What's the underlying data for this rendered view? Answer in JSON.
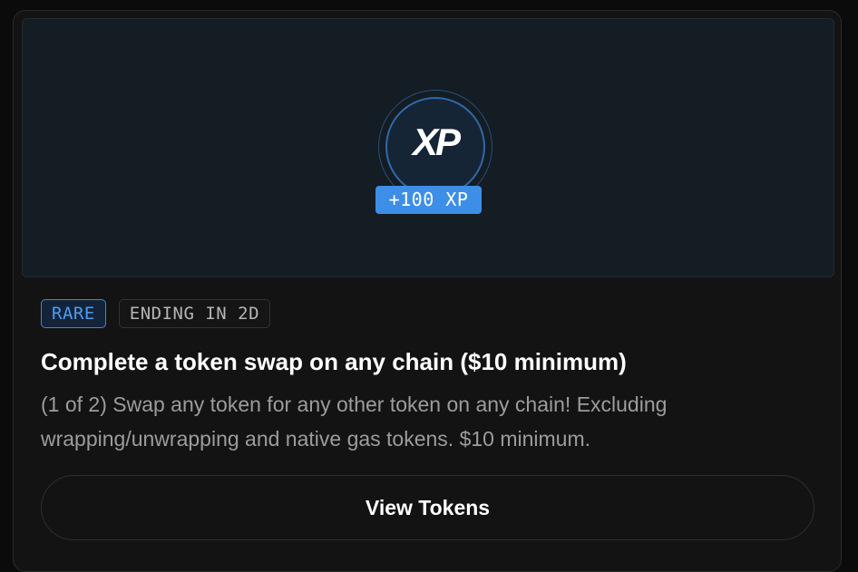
{
  "quest": {
    "logo_text": "XP",
    "reward_badge": "+100 XP",
    "rarity_tag": "RARE",
    "ending_tag": "ENDING IN 2D",
    "title": "Complete a token swap on any chain ($10 minimum)",
    "description": "(1 of 2) Swap any token for any other token on any chain! Excluding wrapping/unwrapping and native gas tokens. $10 minimum.",
    "action_label": "View Tokens"
  },
  "colors": {
    "accent_blue": "#3d8ee6",
    "card_bg": "#131313",
    "hero_bg": "#141c24"
  },
  "icons": {
    "logo": "xp-logo-icon"
  }
}
